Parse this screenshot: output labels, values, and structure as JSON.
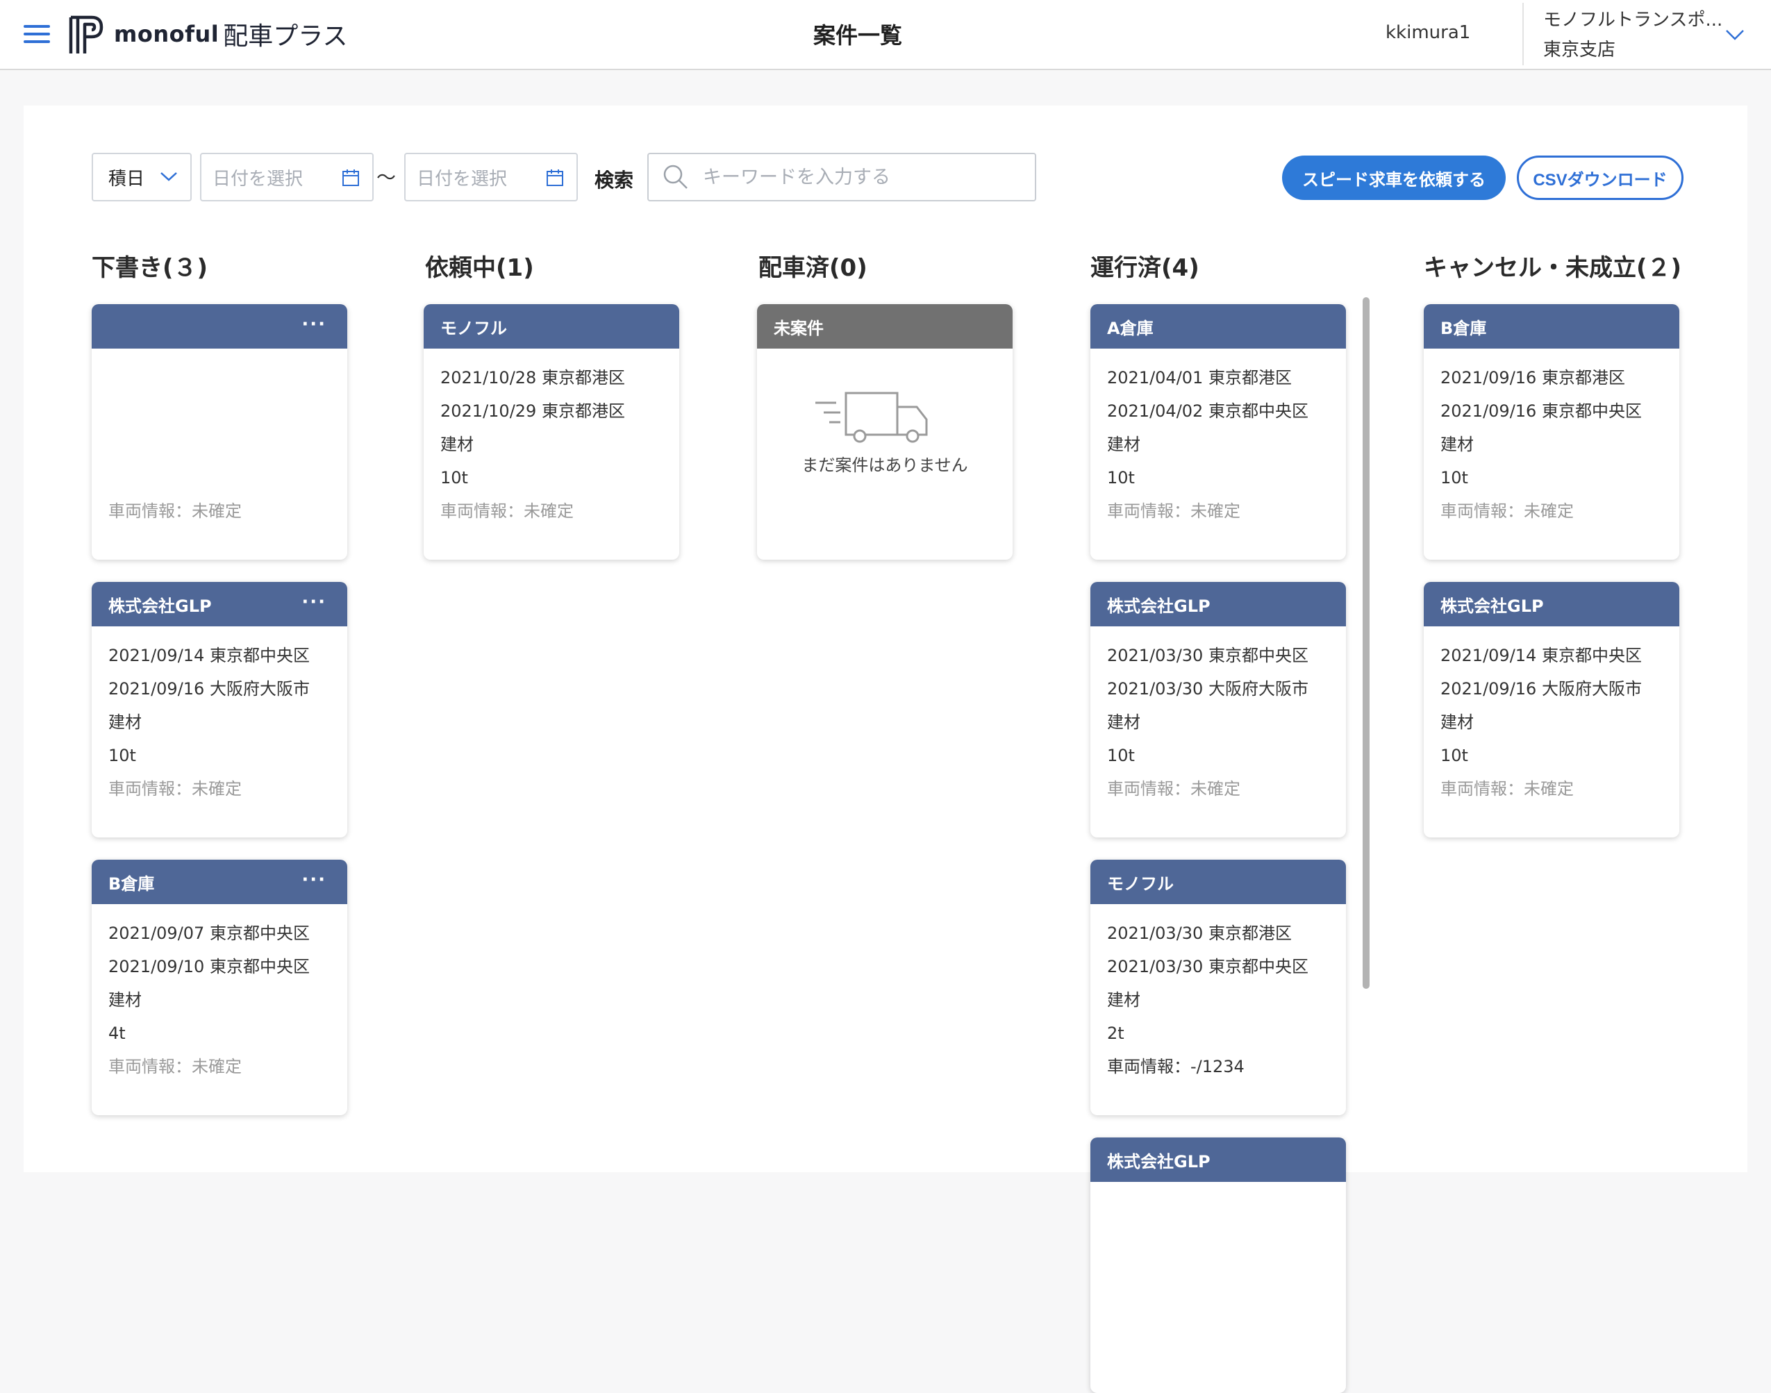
{
  "header": {
    "menu_icon": "hamburger-menu-icon",
    "logo_word": "monoful",
    "logo_jp": "配車プラス",
    "page_title": "案件一覧",
    "user_name": "kkimura1",
    "company_name": "モノフルトランスポ...",
    "company_branch": "東京支店"
  },
  "toolbar": {
    "date_type": "積日",
    "date_from_placeholder": "日付を選択",
    "date_to_placeholder": "日付を選択",
    "tilde": "〜",
    "search_label": "検索",
    "search_placeholder": "キーワードを入力する",
    "speed_button": "スピード求車を依頼する",
    "csv_button": "CSVダウンロード"
  },
  "columns": [
    {
      "title": "下書き(３)",
      "cards": [
        {
          "header": "",
          "more": "···",
          "lines": [
            "",
            "",
            "",
            ""
          ],
          "vehicle": "車両情報：未確定"
        },
        {
          "header": "株式会社GLP",
          "more": "···",
          "lines": [
            "2021/09/14 東京都中央区",
            "2021/09/16 大阪府大阪市",
            "建材",
            "10t"
          ],
          "vehicle": "車両情報：未確定"
        },
        {
          "header": "B倉庫",
          "more": "···",
          "lines": [
            "2021/09/07 東京都中央区",
            "2021/09/10 東京都中央区",
            "建材",
            "4t"
          ],
          "vehicle": "車両情報：未確定"
        }
      ]
    },
    {
      "title": "依頼中(1)",
      "cards": [
        {
          "header": "モノフル",
          "lines": [
            "2021/10/28 東京都港区",
            "2021/10/29 東京都港区",
            "建材",
            "10t"
          ],
          "vehicle": "車両情報：未確定"
        }
      ]
    },
    {
      "title": "配車済(0)",
      "cards": [
        {
          "header": "未案件",
          "empty_text": "まだ案件はありません"
        }
      ]
    },
    {
      "title": "運行済(4)",
      "cards": [
        {
          "header": "A倉庫",
          "lines": [
            "2021/04/01 東京都港区",
            "2021/04/02 東京都中央区",
            "建材",
            "10t"
          ],
          "vehicle": "車両情報：未確定"
        },
        {
          "header": "株式会社GLP",
          "lines": [
            "2021/03/30 東京都中央区",
            "2021/03/30 大阪府大阪市",
            "建材",
            "10t"
          ],
          "vehicle": "車両情報：未確定"
        },
        {
          "header": "モノフル",
          "lines": [
            "2021/03/30 東京都港区",
            "2021/03/30 東京都中央区",
            "建材",
            "2t"
          ],
          "vehicle": "車両情報：-/1234"
        },
        {
          "header": "株式会社GLP"
        }
      ]
    },
    {
      "title": "キャンセル・未成立(２)",
      "cards": [
        {
          "header": "B倉庫",
          "lines": [
            "2021/09/16 東京都港区",
            "2021/09/16 東京都中央区",
            "建材",
            "10t"
          ],
          "vehicle": "車両情報：未確定"
        },
        {
          "header": "株式会社GLP",
          "lines": [
            "2021/09/14 東京都中央区",
            "2021/09/16 大阪府大阪市",
            "建材",
            "10t"
          ],
          "vehicle": "車両情報：未確定"
        }
      ]
    }
  ]
}
